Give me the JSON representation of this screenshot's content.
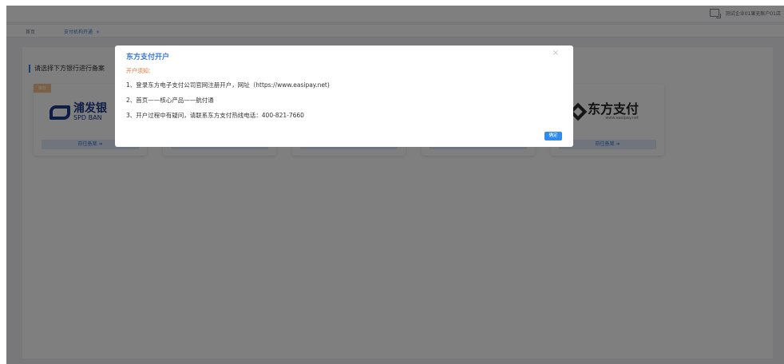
{
  "topbar": {
    "user_label": "测试企业01果无账户01店"
  },
  "tabs": [
    {
      "label": "首页"
    },
    {
      "label": "支付机构开通",
      "close": "×"
    }
  ],
  "main": {
    "hint": "请选择下方银行进行备案",
    "cards": [
      {
        "tag": "推荐",
        "logo_cn": "浦发银",
        "logo_en": "SPD BAN",
        "go": "前往备案 ➜"
      },
      {
        "logo_cn": "东方支付",
        "logo_url": "www.easipay.net",
        "go": "前往备案 ➜"
      }
    ]
  },
  "dialog": {
    "title": "东方支付开户",
    "close": "×",
    "notice": "开户须知：",
    "lines": [
      "1、登录东方电子支付公司官网注册开户，网址（https://www.easipay.net)",
      "2、首页——核心产品——航付通",
      "3、开户过程中有疑问，请联系东方支付热线电话：400-821-7660"
    ],
    "confirm": "确定"
  }
}
